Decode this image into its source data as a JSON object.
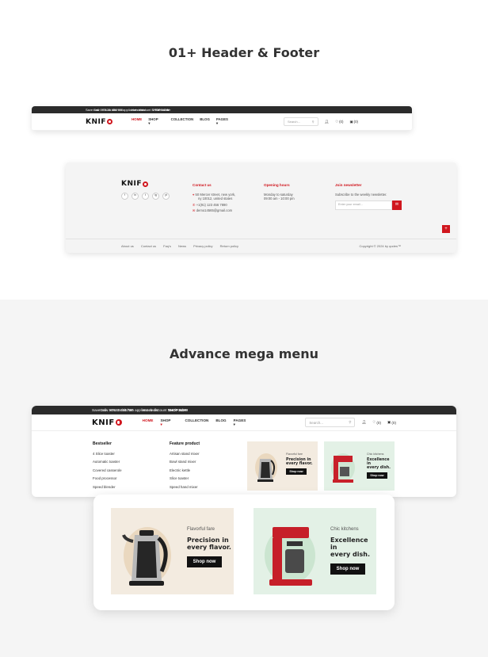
{
  "section1": {
    "title": "01+ Header & Footer"
  },
  "section2": {
    "title": "Advance mega menu"
  },
  "header": {
    "promo_text": "Save now 50% on kitchen appliances discount",
    "promo_link": "SHOP NOW",
    "call": "Call : +0123 456 789",
    "hot_deals": "Hot deals!",
    "track_order": "Track order",
    "logo": "KNIF",
    "nav": [
      "HOME",
      "SHOP",
      "COLLECTION",
      "BLOG",
      "PAGES"
    ],
    "search_placeholder": "Search...",
    "wishlist_count": "(0)",
    "cart_count": "(0)"
  },
  "footer": {
    "logo": "KNIF",
    "social": [
      "f",
      "in",
      "t",
      "ig",
      "yt"
    ],
    "contact_title": "Contact us",
    "address_line1": "50 Mercer street, new york,",
    "address_line2": "ny 10012, united states",
    "phone": "+1(91) 123 456 7890",
    "email": "demo14565@gmail.com",
    "hours_title": "Opening hours",
    "hours_days": "Monday to saturday",
    "hours_time": "09:00 am - 10:00 pm",
    "newsletter_title": "Join newsletter",
    "newsletter_text": "Subscribe to the weekly newsletter.",
    "email_placeholder": "Enter your email...",
    "links": [
      "About us",
      "Contact us",
      "Faq's",
      "News",
      "Privacy policy",
      "Return policy"
    ],
    "copyright": "Copyright © 2024 by qodes™"
  },
  "mega": {
    "bestseller_title": "Bestseller",
    "bestseller": [
      "4 Slice toaster",
      "Automatic toaster",
      "Covered casserole",
      "Food processor",
      "Speed blender"
    ],
    "feature_title": "Feature product",
    "feature": [
      "Artisan stand mixer",
      "Bowl stand mixer",
      "Electric kettle",
      "Slice toaster",
      "Speed hand mixer"
    ],
    "promo1": {
      "small": "Flavorful fare",
      "line1": "Precision in",
      "line2": "every flavor.",
      "button": "Shop now",
      "bg": "#f3ebe0"
    },
    "promo2": {
      "small": "Chic kitchens",
      "line1": "Excellence in",
      "line2": "every dish.",
      "button": "Shop now",
      "bg": "#e3f1e6"
    }
  },
  "colors": {
    "accent": "#d0161e",
    "topbar": "#2b2b2b"
  }
}
